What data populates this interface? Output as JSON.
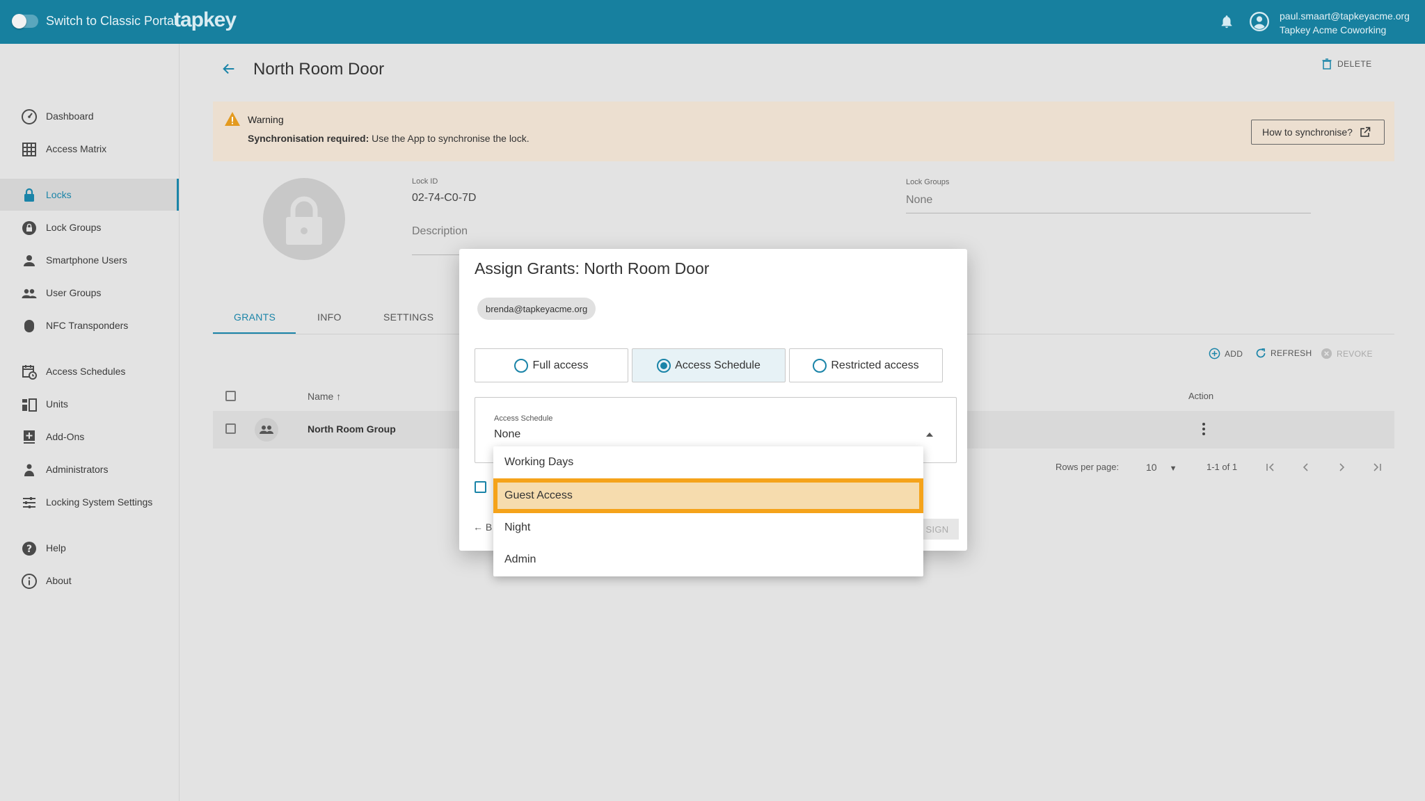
{
  "topbar": {
    "switch_label": "Switch to Classic Portal",
    "logo": "tapkey",
    "user_email": "paul.smaart@tapkeyacme.org",
    "user_org": "Tapkey Acme Coworking",
    "bg_color": "#17809f"
  },
  "sidebar": {
    "items": [
      {
        "label": "Dashboard",
        "icon": "dashboard-icon"
      },
      {
        "label": "Access Matrix",
        "icon": "grid-icon"
      },
      {
        "label": "Locks",
        "icon": "lock-icon",
        "active": true
      },
      {
        "label": "Lock Groups",
        "icon": "lock-group-icon"
      },
      {
        "label": "Smartphone Users",
        "icon": "person-icon"
      },
      {
        "label": "User Groups",
        "icon": "people-icon"
      },
      {
        "label": "NFC Transponders",
        "icon": "nfc-icon"
      },
      {
        "label": "Access Schedules",
        "icon": "calendar-clock-icon"
      },
      {
        "label": "Units",
        "icon": "units-icon"
      },
      {
        "label": "Add-Ons",
        "icon": "add-box-icon"
      },
      {
        "label": "Administrators",
        "icon": "admin-icon"
      },
      {
        "label": "Locking System Settings",
        "icon": "sliders-icon"
      },
      {
        "label": "Help",
        "icon": "help-icon"
      },
      {
        "label": "About",
        "icon": "info-icon"
      }
    ]
  },
  "page": {
    "title": "North Room Door",
    "delete_label": "DELETE"
  },
  "warning": {
    "title": "Warning",
    "bold_text": "Synchronisation required:",
    "text": " Use the App to synchronise the lock.",
    "button": "How to synchronise?"
  },
  "lock": {
    "id_label": "Lock ID",
    "id_value": "02-74-C0-7D",
    "groups_label": "Lock Groups",
    "groups_value": "None",
    "description_placeholder": "Description"
  },
  "tabs": [
    "GRANTS",
    "INFO",
    "SETTINGS"
  ],
  "toolbar": {
    "add": "ADD",
    "refresh": "REFRESH",
    "revoke": "REVOKE"
  },
  "table": {
    "columns": {
      "name": "Name",
      "action": "Action"
    },
    "rows": [
      {
        "name": "North Room Group"
      }
    ],
    "rows_per_page_label": "Rows per page:",
    "rows_per_page": "10",
    "range": "1-1 of 1"
  },
  "dialog": {
    "title": "Assign Grants: North Room Door",
    "chip": "brenda@tapkeyacme.org",
    "options": [
      "Full access",
      "Access Schedule",
      "Restricted access"
    ],
    "selected_option": "Access Schedule",
    "select_label": "Access Schedule",
    "select_value": "None",
    "back_label": "B",
    "assign_label": "SIGN"
  },
  "dropdown": {
    "options": [
      "Working Days",
      "Guest Access",
      "Night",
      "Admin"
    ],
    "highlighted": "Guest Access",
    "highlight_color": "#f5a31a"
  }
}
